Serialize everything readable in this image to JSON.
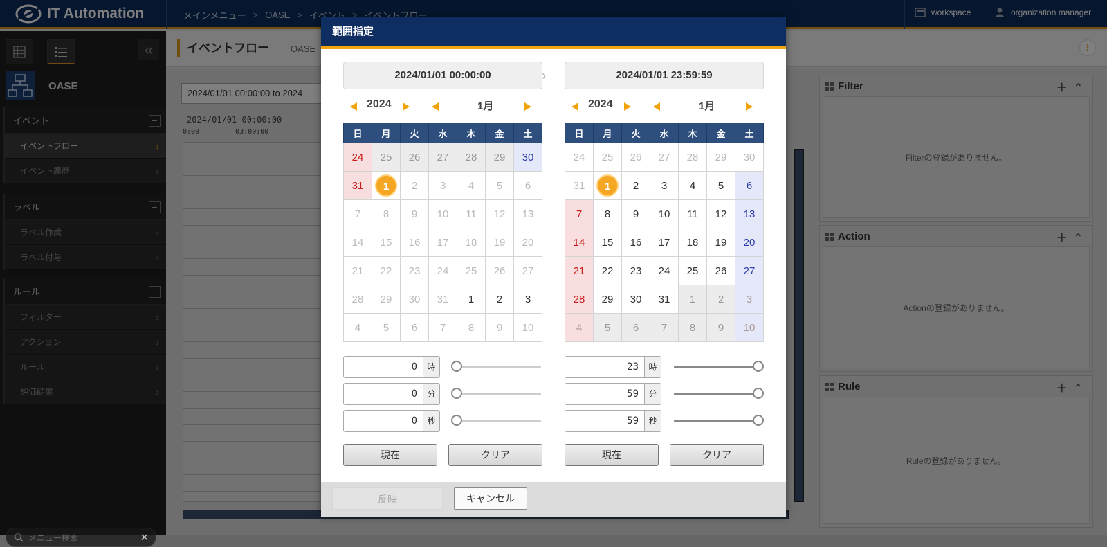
{
  "header": {
    "app_name": "IT Automation",
    "breadcrumbs": [
      "メインメニュー",
      "OASE",
      "イベント",
      "イベントフロー"
    ],
    "workspace_label": "workspace",
    "user_label": "organization manager",
    "accent_color": "#e39a1b",
    "bg_color": "#0b2c5c"
  },
  "sidebar": {
    "app_label": "OASE",
    "groups": [
      {
        "title": "イベント",
        "items": [
          "イベントフロー",
          "イベント履歴"
        ]
      },
      {
        "title": "ラベル",
        "items": [
          "ラベル作成",
          "ラベル付与"
        ]
      },
      {
        "title": "ルール",
        "items": [
          "フィルター",
          "アクション",
          "ルール",
          "評価結果"
        ]
      }
    ],
    "search_placeholder": "メニュー検索"
  },
  "page": {
    "title": "イベントフロー",
    "subtitle": "OASE"
  },
  "timeline": {
    "range_value": "2024/01/01 00:00:00 to 2024",
    "start_label": "2024/01/01 00:00:00",
    "ticks": [
      "0:00",
      "03:00:00"
    ]
  },
  "panels": [
    {
      "title": "Filter",
      "empty": "Filterの登録がありません。"
    },
    {
      "title": "Action",
      "empty": "Actionの登録がありません。"
    },
    {
      "title": "Rule",
      "empty": "Ruleの登録がありません。"
    }
  ],
  "modal": {
    "title": "範囲指定",
    "weekdays": [
      "日",
      "月",
      "火",
      "水",
      "木",
      "金",
      "土"
    ],
    "apply_label": "反映",
    "cancel_label": "キャンセル",
    "now_label": "現在",
    "clear_label": "クリア",
    "units": [
      "時",
      "分",
      "秒"
    ],
    "start": {
      "datetime": "2024/01/01 00:00:00",
      "year": "2024",
      "month": "1月",
      "hour": "0",
      "minute": "0",
      "second": "0",
      "days": [
        [
          "24",
          "25",
          "26",
          "27",
          "28",
          "29",
          "30"
        ],
        [
          "31",
          "1",
          "2",
          "3",
          "4",
          "5",
          "6"
        ],
        [
          "7",
          "8",
          "9",
          "10",
          "11",
          "12",
          "13"
        ],
        [
          "14",
          "15",
          "16",
          "17",
          "18",
          "19",
          "20"
        ],
        [
          "21",
          "22",
          "23",
          "24",
          "25",
          "26",
          "27"
        ],
        [
          "28",
          "29",
          "30",
          "31",
          "1",
          "2",
          "3"
        ],
        [
          "4",
          "5",
          "6",
          "7",
          "8",
          "9",
          "10"
        ]
      ]
    },
    "end": {
      "datetime": "2024/01/01 23:59:59",
      "year": "2024",
      "month": "1月",
      "hour": "23",
      "minute": "59",
      "second": "59",
      "days": [
        [
          "24",
          "25",
          "26",
          "27",
          "28",
          "29",
          "30"
        ],
        [
          "31",
          "1",
          "2",
          "3",
          "4",
          "5",
          "6"
        ],
        [
          "7",
          "8",
          "9",
          "10",
          "11",
          "12",
          "13"
        ],
        [
          "14",
          "15",
          "16",
          "17",
          "18",
          "19",
          "20"
        ],
        [
          "21",
          "22",
          "23",
          "24",
          "25",
          "26",
          "27"
        ],
        [
          "28",
          "29",
          "30",
          "31",
          "1",
          "2",
          "3"
        ],
        [
          "4",
          "5",
          "6",
          "7",
          "8",
          "9",
          "10"
        ]
      ]
    }
  }
}
